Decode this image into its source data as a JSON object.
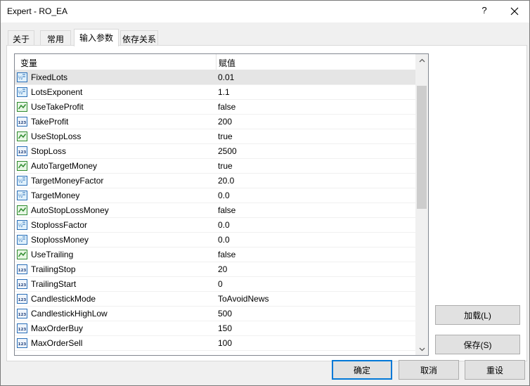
{
  "window": {
    "title": "Expert - RO_EA",
    "help_label": "?"
  },
  "tabs": [
    {
      "label": "关于"
    },
    {
      "label": "常用"
    },
    {
      "label": "输入参数",
      "active": true
    },
    {
      "label": "依存关系"
    }
  ],
  "table": {
    "headers": {
      "variable": "变量",
      "value": "赋值"
    },
    "rows": [
      {
        "name": "FixedLots",
        "value": "0.01",
        "icon": "double-value-icon"
      },
      {
        "name": "LotsExponent",
        "value": "1.1",
        "icon": "double-value-icon"
      },
      {
        "name": "UseTakeProfit",
        "value": "false",
        "icon": "boolean-icon"
      },
      {
        "name": "TakeProfit",
        "value": "200",
        "icon": "integer-icon"
      },
      {
        "name": "UseStopLoss",
        "value": "true",
        "icon": "boolean-icon"
      },
      {
        "name": "StopLoss",
        "value": "2500",
        "icon": "integer-icon"
      },
      {
        "name": "AutoTargetMoney",
        "value": "true",
        "icon": "boolean-icon"
      },
      {
        "name": "TargetMoneyFactor",
        "value": "20.0",
        "icon": "double-value-icon"
      },
      {
        "name": "TargetMoney",
        "value": "0.0",
        "icon": "double-value-icon"
      },
      {
        "name": "AutoStopLossMoney",
        "value": "false",
        "icon": "boolean-icon"
      },
      {
        "name": "StoplossFactor",
        "value": "0.0",
        "icon": "double-value-icon"
      },
      {
        "name": "StoplossMoney",
        "value": "0.0",
        "icon": "double-value-icon"
      },
      {
        "name": "UseTrailing",
        "value": "false",
        "icon": "boolean-icon"
      },
      {
        "name": "TrailingStop",
        "value": "20",
        "icon": "integer-icon"
      },
      {
        "name": "TrailingStart",
        "value": "0",
        "icon": "integer-icon"
      },
      {
        "name": "CandlestickMode",
        "value": "ToAvoidNews",
        "icon": "integer-icon"
      },
      {
        "name": "CandlestickHighLow",
        "value": "500",
        "icon": "integer-icon"
      },
      {
        "name": "MaxOrderBuy",
        "value": "150",
        "icon": "integer-icon"
      },
      {
        "name": "MaxOrderSell",
        "value": "100",
        "icon": "integer-icon"
      }
    ]
  },
  "side_buttons": {
    "load": "加载(L)",
    "save": "保存(S)"
  },
  "footer_buttons": {
    "ok": "确定",
    "cancel": "取消",
    "reset": "重设"
  },
  "colors": {
    "selected_row": "#e5e5e5",
    "default_button_border": "#0078d7",
    "icon_blue": "#2a6fb8",
    "icon_green": "#2e8b2e"
  }
}
